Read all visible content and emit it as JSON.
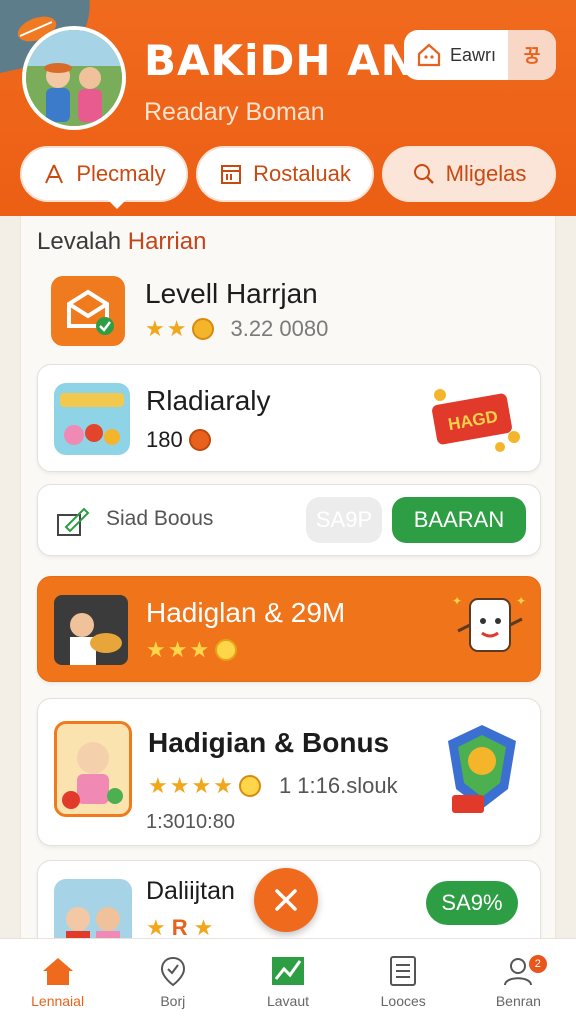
{
  "header": {
    "title": "BAKiDH AN",
    "subtitle": "Readary Boman",
    "earn_label": "Eawrı",
    "earn_right": "꿍"
  },
  "tabs": [
    {
      "label": "Plecmaly",
      "icon": "person-icon"
    },
    {
      "label": "Rostaluak",
      "icon": "calendar-icon"
    },
    {
      "label": "Mligelas",
      "icon": "search-icon"
    }
  ],
  "section": {
    "title_plain": "Levalah ",
    "title_highlight": "Harrian"
  },
  "cards": {
    "level": {
      "title": "Levell Harrjan",
      "meta": "3.22 0080"
    },
    "daily": {
      "title": "Rladiaraly",
      "value": "180",
      "banner_text": "HAGD"
    },
    "bonus": {
      "label": "Siad Boous",
      "disabled_button": "SA9P",
      "action_button": "BAARAN"
    },
    "highlight": {
      "title": "Hadiglan & 29M"
    },
    "hadigian": {
      "title": "Hadigian & Bonus",
      "meta": "1 1:16.slouk",
      "time": "1:3010:80"
    },
    "daliujan": {
      "title": "Daliijtan",
      "badge": "R",
      "button": "SA9%"
    }
  },
  "bottom_nav": [
    {
      "label": "Lennaial",
      "icon": "home-icon",
      "active": true
    },
    {
      "label": "Borj",
      "icon": "location-icon",
      "active": false
    },
    {
      "label": "Lavaut",
      "icon": "chart-icon",
      "active": false
    },
    {
      "label": "Looces",
      "icon": "list-icon",
      "active": false
    },
    {
      "label": "Benran",
      "icon": "profile-icon",
      "active": false,
      "badge": "2"
    }
  ],
  "colors": {
    "primary": "#f06a1e",
    "green": "#2e9e45",
    "text": "#1c1c1c"
  }
}
